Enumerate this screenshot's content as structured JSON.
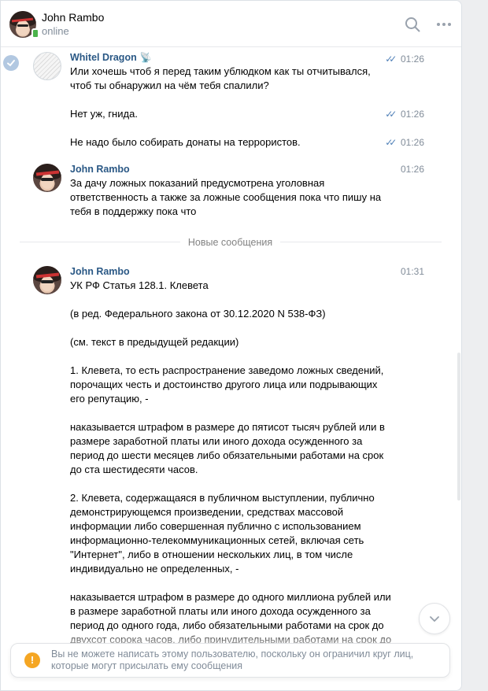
{
  "header": {
    "name": "John Rambo",
    "status": "online"
  },
  "messages": [
    {
      "author": "Whitel Dragon",
      "author_badge": "📡",
      "items": [
        {
          "text": "Или хочешь чтоб я перед таким ублюдком как ты отчитывался,\nчтоб ты обнаружил на чём тебя спалили?",
          "time": "01:26",
          "read": true
        },
        {
          "text": "Нет уж, гнида.",
          "time": "01:26",
          "read": true
        },
        {
          "text": "Не надо было собирать донаты на террористов.",
          "time": "01:26",
          "read": true
        }
      ]
    },
    {
      "author": "John Rambo",
      "time": "01:26",
      "text": "За дачу ложных показаний предусмотрена уголовная\nответственность а также за ложные сообщения пока что пишу на\nтебя в поддержку пока что"
    },
    {
      "author": "John Rambo",
      "time": "01:31",
      "text": "УК РФ Статья 128.1. Клевета\n\n(в ред. Федерального закона от 30.12.2020 N 538-ФЗ)\n\n(см. текст в предыдущей редакции)\n\n1. Клевета, то есть распространение заведомо ложных сведений,\nпорочащих честь и достоинство другого лица или подрывающих\nего репутацию, -\n\nнаказывается штрафом в размере до пятисот тысяч рублей или в\nразмере заработной платы или иного дохода осужденного за\nпериод до шести месяцев либо обязательными работами на срок\nдо ста шестидесяти часов.\n\n2. Клевета, содержащаяся в публичном выступлении, публично\nдемонстрирующемся произведении, средствах массовой\nинформации либо совершенная публично с использованием\nинформационно-телекоммуникационных сетей, включая сеть\n\"Интернет\", либо в отношении нескольких лиц, в том числе\nиндивидуально не определенных, -\n\nнаказывается штрафом в размере до одного миллиона рублей или\nв размере заработной платы или иного дохода осужденного за\nпериод до одного года, либо обязательными работами на срок до\nдвухсот сорока часов, либо принудительными работами на срок до"
    }
  ],
  "divider_label": "Новые сообщения",
  "notice_text": "Вы не можете написать этому пользователю, поскольку он ограничил круг лиц,\nкоторые могут присылать ему сообщения",
  "colors": {
    "author": "#2a5885",
    "muted": "#818c99",
    "online": "#4bb34b",
    "info": "#f5a623",
    "tick": "#5181b8"
  },
  "icons": [
    "search-icon",
    "more-icon",
    "check-icon",
    "chevron-down-icon",
    "info-icon",
    "double-check-icon"
  ]
}
